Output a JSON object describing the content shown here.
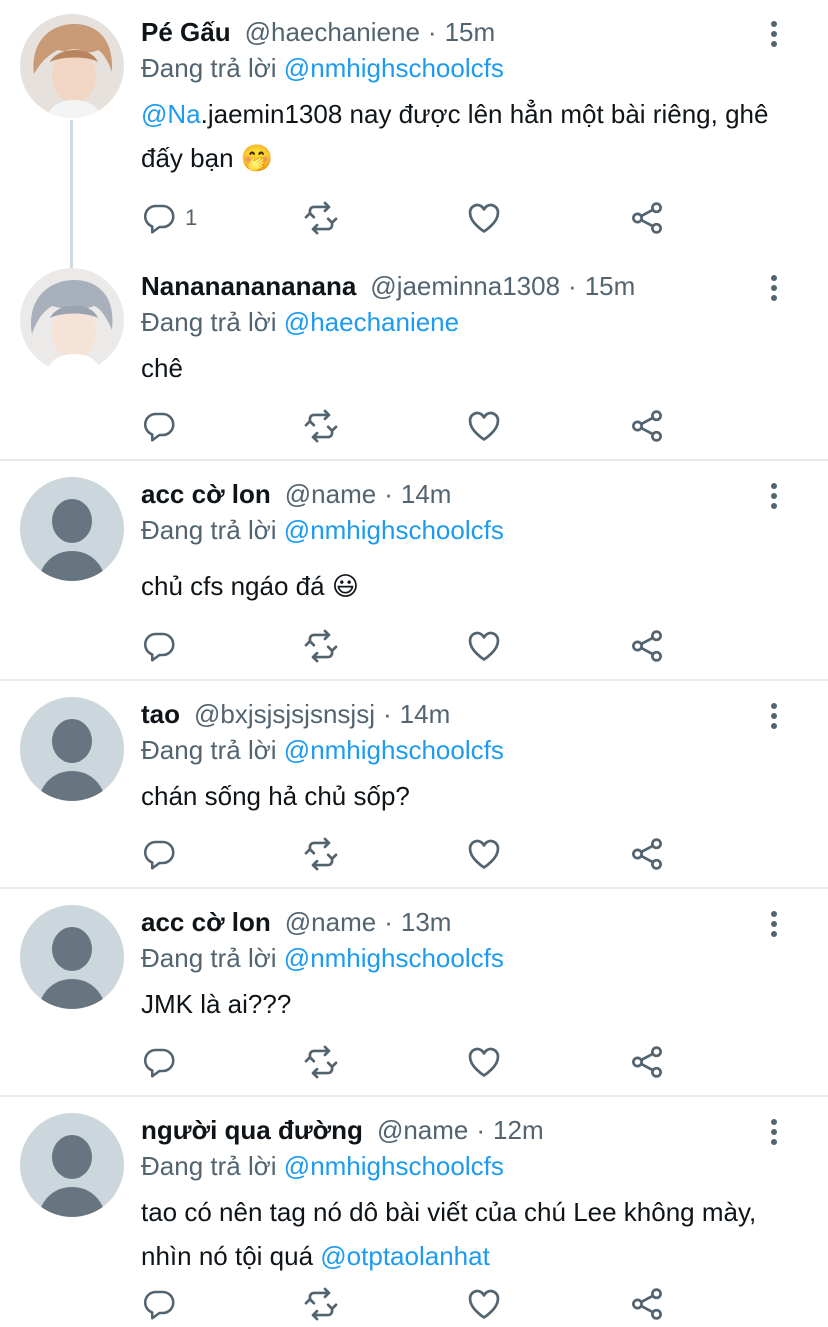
{
  "reply_prefix": "Đang trả lời",
  "colors": {
    "accent": "#1d9bf0",
    "muted": "#536471",
    "text": "#0f1419",
    "divider": "#e7ebee"
  },
  "icons": {
    "reply": "reply-icon",
    "retweet": "retweet-icon",
    "like": "heart-icon",
    "share": "share-icon",
    "more": "more-options-icon"
  },
  "tweets": [
    {
      "name": "Pé Gấu",
      "handle": "@haechaniene",
      "time": "15m",
      "reply_to": "@nmhighschoolcfs",
      "mention": "@Na",
      "text_rest": ".jaemin1308 nay được lên hẳn một bài riêng, ghê đấy bạn",
      "emoji": "🤭",
      "reply_count": "1"
    },
    {
      "name": "Nanananananana",
      "handle": "@jaeminna1308",
      "time": "15m",
      "reply_to": "@haechaniene",
      "text": "chê"
    },
    {
      "name": "acc cờ lon",
      "handle": "@name",
      "time": "14m",
      "reply_to": "@nmhighschoolcfs",
      "text": "chủ cfs ngáo đá",
      "emoji": "😃"
    },
    {
      "name": "tao",
      "handle": "@bxjsjsjsjsnsjsj",
      "time": "14m",
      "reply_to": "@nmhighschoolcfs",
      "text": "chán sống hả chủ sốp?"
    },
    {
      "name": "acc cờ lon",
      "handle": "@name",
      "time": "13m",
      "reply_to": "@nmhighschoolcfs",
      "text": "JMK là ai???"
    },
    {
      "name": "người qua đường",
      "handle": "@name",
      "time": "12m",
      "reply_to": "@nmhighschoolcfs",
      "text": "tao có nên tag nó dô bài viết của chú Lee không mày, nhìn nó tội quá",
      "mention_end": "@otptaolanhat"
    }
  ]
}
